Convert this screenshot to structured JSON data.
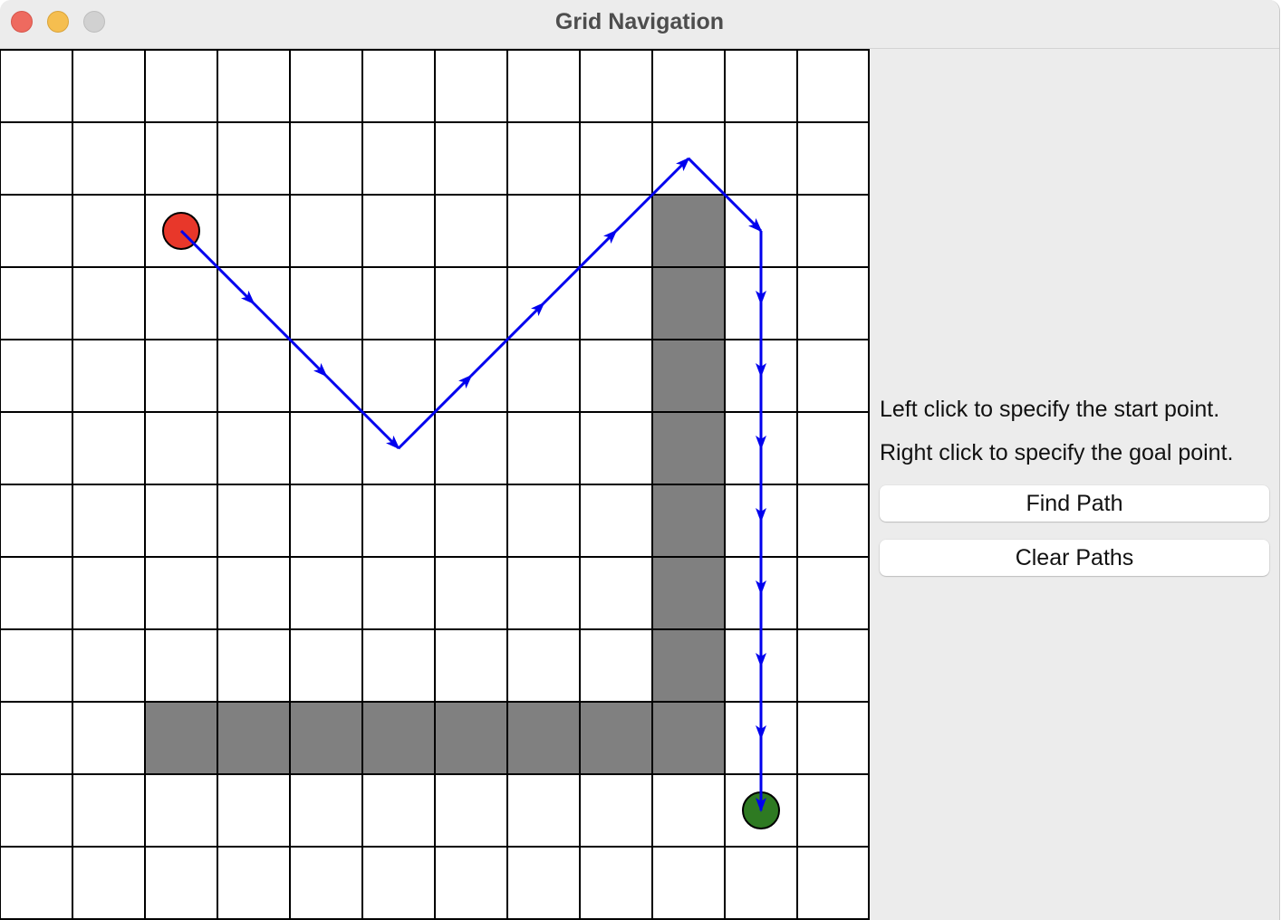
{
  "window": {
    "title": "Grid Navigation"
  },
  "grid": {
    "rows": 12,
    "cols": 12,
    "obstacle_color": "#808080",
    "obstacles": [
      [
        2,
        9
      ],
      [
        3,
        9
      ],
      [
        4,
        9
      ],
      [
        5,
        9
      ],
      [
        6,
        9
      ],
      [
        7,
        9
      ],
      [
        8,
        9
      ],
      [
        9,
        2
      ],
      [
        9,
        3
      ],
      [
        9,
        4
      ],
      [
        9,
        5
      ],
      [
        9,
        6
      ],
      [
        9,
        7
      ],
      [
        9,
        8
      ],
      [
        9,
        9
      ]
    ],
    "start": {
      "row": 2,
      "col": 2,
      "color": "#e8372a"
    },
    "goal": {
      "row": 10,
      "col": 10,
      "color": "#2e7a22"
    },
    "path_color": "#0000ee",
    "path": [
      [
        2,
        2
      ],
      [
        3,
        3
      ],
      [
        4,
        4
      ],
      [
        5,
        5
      ],
      [
        4,
        6
      ],
      [
        3,
        7
      ],
      [
        2,
        8
      ],
      [
        1,
        9
      ],
      [
        2,
        10
      ],
      [
        3,
        10
      ],
      [
        4,
        10
      ],
      [
        5,
        10
      ],
      [
        6,
        10
      ],
      [
        7,
        10
      ],
      [
        8,
        10
      ],
      [
        9,
        10
      ],
      [
        10,
        10
      ]
    ]
  },
  "panel": {
    "instruction_start": "Left click to specify the start point.",
    "instruction_goal": "Right click to specify the goal point.",
    "find_path_label": "Find Path",
    "clear_paths_label": "Clear Paths"
  }
}
